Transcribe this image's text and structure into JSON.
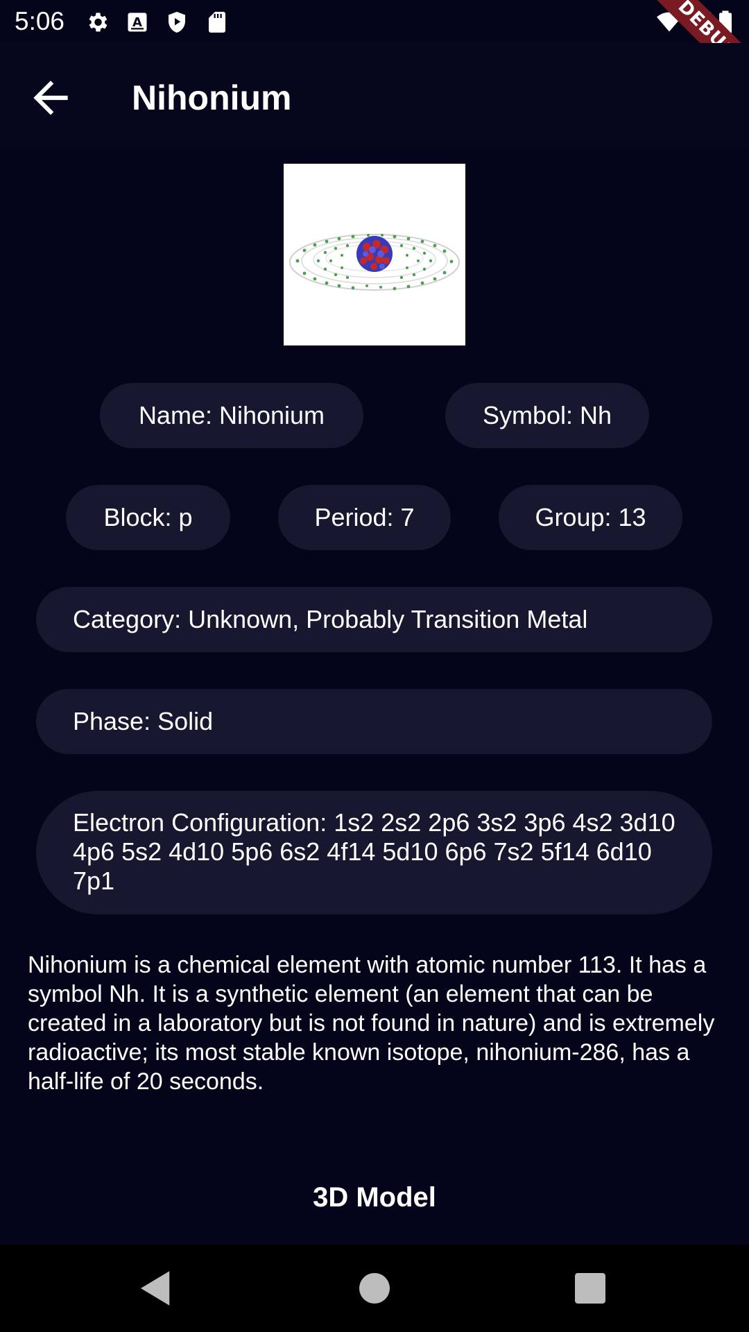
{
  "status_bar": {
    "time": "5:06",
    "debug_label": "DEBUG",
    "icons": [
      "settings-icon",
      "keyboard-a-icon",
      "shield-play-icon",
      "sd-card-icon",
      "wifi-icon",
      "signal-icon",
      "battery-icon"
    ]
  },
  "app_bar": {
    "title": "Nihonium",
    "back_icon": "arrow-back-icon"
  },
  "element": {
    "image_alt": "Nihonium atom model",
    "name_chip": "Name: Nihonium",
    "symbol_chip": "Symbol: Nh",
    "block_chip": "Block: p",
    "period_chip": "Period: 7",
    "group_chip": "Group: 13",
    "category_chip": "Category: Unknown, Probably Transition Metal",
    "phase_chip": "Phase: Solid",
    "electron_config_chip": "Electron Configuration: 1s2 2s2 2p6 3s2 3p6 4s2 3d10 4p6 5s2 4d10 5p6 6s2 4f14 5d10 6p6 7s2 5f14 6d10 7p1",
    "description": "Nihonium is a chemical element with atomic number 113. It has a symbol Nh. It is a synthetic element (an element that can be created in a laboratory but is not found in nature) and is extremely radioactive; its most stable known isotope, nihonium-286, has a half-life of 20 seconds."
  },
  "actions": {
    "model_button": "3D Model"
  },
  "nav_bar": {
    "icons": [
      "back-triangle-icon",
      "home-circle-icon",
      "recents-square-icon"
    ]
  },
  "colors": {
    "background": "#04041a",
    "chip": "#171830",
    "debug_banner": "#7a1a22"
  }
}
